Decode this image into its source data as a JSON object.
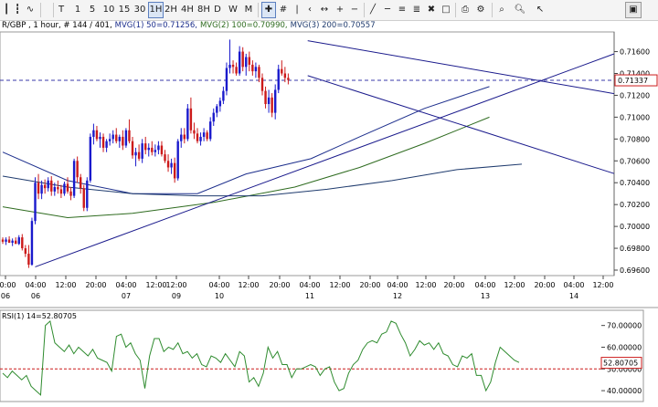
{
  "toolbar": {
    "items": [
      "T",
      "1",
      "5",
      "10",
      "15",
      "30",
      "1H",
      "2H",
      "4H",
      "8H",
      "D",
      "W",
      "M"
    ],
    "selected": "1H"
  },
  "header": {
    "symbol_text": "R/GBP , 1 hour, # 144 / 401,",
    "mvg1_text": "MVG(1) 50=0.71256,",
    "mvg2_text": "MVG(2) 100=0.70990,",
    "mvg3_text": "MVG(3) 200=0.70557"
  },
  "colors": {
    "candle_up": "#1a1acc",
    "candle_down": "#cc1a1a",
    "mvg1": "#1c2e8c",
    "mvg2": "#2e6b1f",
    "mvg3": "#1f3b6e",
    "trendline": "#1a1a8c",
    "price_line": "#3a3aa8",
    "rsi_line": "#2e8b2e",
    "rsi_level": "#cc1a1a"
  },
  "chart_data": [
    {
      "type": "candlestick",
      "title": "",
      "ylim": [
        0.6955,
        0.7178
      ],
      "y_ticks": [
        "0.71600",
        "0.71400",
        "0.71200",
        "0.71000",
        "0.70800",
        "0.70600",
        "0.70400",
        "0.70200",
        "0.70000",
        "0.69800",
        "0.69600"
      ],
      "current_price": "0.71337",
      "x_labels": [
        {
          "t": "20:00",
          "d": "06"
        },
        {
          "t": "04:00",
          "d": "06"
        },
        {
          "t": "12:00",
          "d": ""
        },
        {
          "t": "20:00",
          "d": ""
        },
        {
          "t": "04:00",
          "d": "07"
        },
        {
          "t": "12:00",
          "d": ""
        },
        {
          "t": "12:00",
          "d": "09"
        },
        {
          "t": "04:00",
          "d": "10"
        },
        {
          "t": "12:00",
          "d": ""
        },
        {
          "t": "20:00",
          "d": ""
        },
        {
          "t": "04:00",
          "d": "11"
        },
        {
          "t": "12:00",
          "d": ""
        },
        {
          "t": "20:00",
          "d": ""
        },
        {
          "t": "04:00",
          "d": "12"
        },
        {
          "t": "12:00",
          "d": ""
        },
        {
          "t": "20:00",
          "d": ""
        },
        {
          "t": "04:00",
          "d": "13"
        },
        {
          "t": "12:00",
          "d": ""
        },
        {
          "t": "20:00",
          "d": ""
        },
        {
          "t": "04:00",
          "d": "14"
        },
        {
          "t": "12:00",
          "d": ""
        }
      ],
      "candles": [
        [
          0.6988,
          0.699,
          0.6984,
          0.6986
        ],
        [
          0.6986,
          0.699,
          0.6983,
          0.6988
        ],
        [
          0.6988,
          0.6991,
          0.6985,
          0.6985
        ],
        [
          0.6985,
          0.6989,
          0.6982,
          0.6987
        ],
        [
          0.6987,
          0.699,
          0.6984,
          0.6984
        ],
        [
          0.6984,
          0.6992,
          0.6983,
          0.699
        ],
        [
          0.699,
          0.6993,
          0.6978,
          0.698
        ],
        [
          0.698,
          0.6983,
          0.6972,
          0.6975
        ],
        [
          0.6975,
          0.6983,
          0.6962,
          0.6965
        ],
        [
          0.6965,
          0.7008,
          0.6964,
          0.7005
        ],
        [
          0.7005,
          0.7045,
          0.7002,
          0.704
        ],
        [
          0.704,
          0.7048,
          0.7025,
          0.703
        ],
        [
          0.703,
          0.7042,
          0.7025,
          0.7038
        ],
        [
          0.7038,
          0.7043,
          0.703,
          0.7035
        ],
        [
          0.7035,
          0.7045,
          0.7032,
          0.7042
        ],
        [
          0.7042,
          0.7046,
          0.7028,
          0.7032
        ],
        [
          0.7032,
          0.704,
          0.7028,
          0.7036
        ],
        [
          0.7036,
          0.7042,
          0.703,
          0.7034
        ],
        [
          0.7034,
          0.7038,
          0.7026,
          0.703
        ],
        [
          0.703,
          0.7041,
          0.7028,
          0.7039
        ],
        [
          0.7039,
          0.7045,
          0.703,
          0.7032
        ],
        [
          0.7032,
          0.7036,
          0.7024,
          0.7028
        ],
        [
          0.7028,
          0.7062,
          0.7026,
          0.706
        ],
        [
          0.706,
          0.7064,
          0.704,
          0.7045
        ],
        [
          0.7045,
          0.7048,
          0.703,
          0.7035
        ],
        [
          0.7035,
          0.7038,
          0.7014,
          0.7017
        ],
        [
          0.7017,
          0.7045,
          0.7014,
          0.7042
        ],
        [
          0.7042,
          0.7085,
          0.704,
          0.7082
        ],
        [
          0.7082,
          0.7094,
          0.7075,
          0.7088
        ],
        [
          0.7088,
          0.7092,
          0.7078,
          0.708
        ],
        [
          0.708,
          0.7086,
          0.7072,
          0.7082
        ],
        [
          0.7082,
          0.7085,
          0.7068,
          0.7072
        ],
        [
          0.7072,
          0.708,
          0.7068,
          0.7078
        ],
        [
          0.7078,
          0.7085,
          0.7074,
          0.708
        ],
        [
          0.708,
          0.7088,
          0.7076,
          0.7084
        ],
        [
          0.7084,
          0.709,
          0.7076,
          0.7078
        ],
        [
          0.7078,
          0.7084,
          0.7072,
          0.7082
        ],
        [
          0.7082,
          0.7088,
          0.707,
          0.7074
        ],
        [
          0.7074,
          0.709,
          0.7072,
          0.7088
        ],
        [
          0.7088,
          0.7098,
          0.7076,
          0.7078
        ],
        [
          0.7078,
          0.7082,
          0.7062,
          0.7065
        ],
        [
          0.7065,
          0.7072,
          0.7055,
          0.7068
        ],
        [
          0.7068,
          0.7075,
          0.706,
          0.7062
        ],
        [
          0.7062,
          0.708,
          0.7058,
          0.7076
        ],
        [
          0.7076,
          0.7082,
          0.7066,
          0.707
        ],
        [
          0.707,
          0.7076,
          0.7064,
          0.7072
        ],
        [
          0.7072,
          0.7078,
          0.7065,
          0.7068
        ],
        [
          0.7068,
          0.7075,
          0.7064,
          0.707
        ],
        [
          0.707,
          0.7078,
          0.7066,
          0.7074
        ],
        [
          0.7074,
          0.7078,
          0.7064,
          0.7066
        ],
        [
          0.7066,
          0.707,
          0.7058,
          0.706
        ],
        [
          0.706,
          0.7066,
          0.705,
          0.7054
        ],
        [
          0.7054,
          0.7062,
          0.7048,
          0.7058
        ],
        [
          0.7058,
          0.7063,
          0.704,
          0.7044
        ],
        [
          0.7044,
          0.708,
          0.7042,
          0.7078
        ],
        [
          0.7078,
          0.709,
          0.7072,
          0.7084
        ],
        [
          0.7084,
          0.709,
          0.7076,
          0.708
        ],
        [
          0.708,
          0.7112,
          0.7078,
          0.7108
        ],
        [
          0.7108,
          0.7118,
          0.7085,
          0.7088
        ],
        [
          0.7088,
          0.7095,
          0.708,
          0.7085
        ],
        [
          0.7085,
          0.709,
          0.7076,
          0.7078
        ],
        [
          0.7078,
          0.7086,
          0.7074,
          0.7082
        ],
        [
          0.7082,
          0.709,
          0.7078,
          0.7086
        ],
        [
          0.7086,
          0.7088,
          0.7078,
          0.708
        ],
        [
          0.708,
          0.71,
          0.7078,
          0.7096
        ],
        [
          0.7096,
          0.7108,
          0.7092,
          0.7104
        ],
        [
          0.7104,
          0.7112,
          0.71,
          0.711
        ],
        [
          0.711,
          0.7118,
          0.7105,
          0.7115
        ],
        [
          0.7115,
          0.7128,
          0.7112,
          0.7124
        ],
        [
          0.7124,
          0.715,
          0.712,
          0.7145
        ],
        [
          0.7145,
          0.7171,
          0.714,
          0.7148
        ],
        [
          0.7148,
          0.7152,
          0.714,
          0.7146
        ],
        [
          0.7146,
          0.715,
          0.7138,
          0.714
        ],
        [
          0.714,
          0.7165,
          0.7138,
          0.716
        ],
        [
          0.716,
          0.7164,
          0.7142,
          0.7146
        ],
        [
          0.7146,
          0.7158,
          0.7138,
          0.7155
        ],
        [
          0.7155,
          0.716,
          0.7142,
          0.7148
        ],
        [
          0.7148,
          0.7152,
          0.7138,
          0.7142
        ],
        [
          0.7142,
          0.715,
          0.7136,
          0.7146
        ],
        [
          0.7146,
          0.7148,
          0.7132,
          0.7136
        ],
        [
          0.7136,
          0.714,
          0.712,
          0.7124
        ],
        [
          0.7124,
          0.7128,
          0.7108,
          0.7112
        ],
        [
          0.7112,
          0.7125,
          0.7104,
          0.7118
        ],
        [
          0.7118,
          0.7122,
          0.71,
          0.7104
        ],
        [
          0.7104,
          0.713,
          0.7098,
          0.7125
        ],
        [
          0.7125,
          0.7148,
          0.7122,
          0.7144
        ],
        [
          0.7144,
          0.7152,
          0.7138,
          0.714
        ],
        [
          0.714,
          0.7146,
          0.7132,
          0.7136
        ],
        [
          0.7136,
          0.714,
          0.713,
          0.7134
        ]
      ],
      "moving_averages": [
        {
          "name": "MVG(1) 50",
          "points": [
            [
              0,
              0.7068
            ],
            [
              20,
              0.7042
            ],
            [
              40,
              0.703
            ],
            [
              60,
              0.703
            ],
            [
              75,
              0.7048
            ],
            [
              95,
              0.7062
            ],
            [
              110,
              0.7082
            ],
            [
              130,
              0.7108
            ],
            [
              150,
              0.7128
            ]
          ]
        },
        {
          "name": "MVG(2) 100",
          "points": [
            [
              0,
              0.7018
            ],
            [
              20,
              0.7008
            ],
            [
              40,
              0.7012
            ],
            [
              65,
              0.7022
            ],
            [
              90,
              0.7036
            ],
            [
              110,
              0.7054
            ],
            [
              130,
              0.7076
            ],
            [
              150,
              0.71
            ]
          ]
        },
        {
          "name": "MVG(3) 200",
          "points": [
            [
              0,
              0.7046
            ],
            [
              20,
              0.7036
            ],
            [
              40,
              0.703
            ],
            [
              60,
              0.7028
            ],
            [
              80,
              0.7028
            ],
            [
              100,
              0.7034
            ],
            [
              120,
              0.7042
            ],
            [
              140,
              0.7052
            ],
            [
              160,
              0.7057
            ]
          ]
        }
      ],
      "trendlines": [
        {
          "from": [
            10,
            0.6963
          ],
          "to": [
            172,
            0.714
          ]
        },
        {
          "from": [
            94,
            0.717
          ],
          "to": [
            172,
            0.713
          ]
        },
        {
          "from": [
            94,
            0.7138
          ],
          "to": [
            172,
            0.7064
          ]
        }
      ]
    },
    {
      "type": "line",
      "title": "",
      "label": "RSI(1) 14=52.80705",
      "ylim": [
        35,
        77
      ],
      "y_ticks": [
        "70.00000",
        "60.00000",
        "50.00000",
        "40.00000"
      ],
      "current_value": "52.80705",
      "level": 50,
      "values": [
        48,
        46,
        49,
        47,
        45,
        47,
        42,
        40,
        38,
        70,
        72,
        62,
        60,
        58,
        61,
        57,
        60,
        58,
        56,
        59,
        55,
        54,
        53,
        49,
        65,
        66,
        60,
        62,
        57,
        54,
        41,
        56,
        64,
        64,
        58,
        60,
        59,
        62,
        57,
        58,
        55,
        57,
        52,
        51,
        56,
        55,
        53,
        57,
        54,
        51,
        58,
        56,
        44,
        46,
        42,
        48,
        60,
        55,
        58,
        52,
        52,
        46,
        50,
        50,
        51,
        52,
        51,
        47,
        50,
        51,
        44,
        40,
        41,
        48,
        52,
        54,
        59,
        62,
        63,
        62,
        66,
        67,
        72,
        71,
        66,
        62,
        56,
        59,
        63,
        61,
        62,
        59,
        62,
        57,
        56,
        52,
        51,
        56,
        55,
        57,
        47,
        47,
        40,
        44,
        53,
        60,
        58,
        56,
        54,
        53
      ]
    }
  ]
}
